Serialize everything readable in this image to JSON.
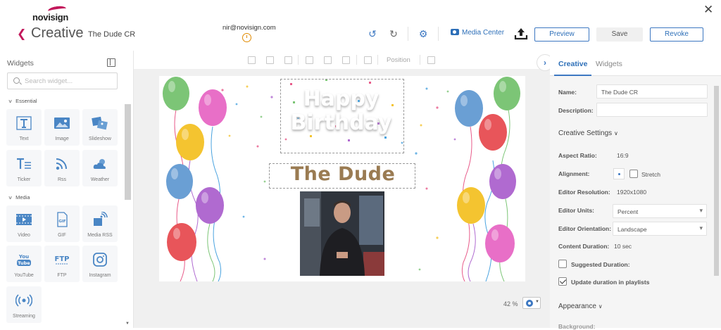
{
  "header": {
    "logo_text": "novisign",
    "app_title": "Creative",
    "creative_name": "The Dude CR",
    "user_email": "nir@novisign.com",
    "media_center_label": "Media Center",
    "preview_label": "Preview",
    "save_label": "Save",
    "revoke_label": "Revoke"
  },
  "widgets_panel": {
    "title": "Widgets",
    "search_placeholder": "Search widget...",
    "sections": [
      {
        "label": "Essential",
        "items": [
          "Text",
          "Image",
          "Slideshow",
          "Ticker",
          "Rss",
          "Weather"
        ]
      },
      {
        "label": "Media",
        "items": [
          "Video",
          "GIF",
          "Media RSS",
          "YouTube",
          "FTP",
          "Instagram",
          "Streaming"
        ]
      }
    ]
  },
  "toolbar": {
    "position_label": "Position"
  },
  "canvas": {
    "happy_text": "Happy",
    "birthday_text": "Birthday",
    "name_text": "The Dude",
    "zoom": "42 %"
  },
  "properties": {
    "tabs": [
      "Creative",
      "Widgets"
    ],
    "name_label": "Name:",
    "name_value": "The Dude CR",
    "description_label": "Description:",
    "description_value": "",
    "creative_settings_label": "Creative Settings",
    "aspect_ratio_label": "Aspect Ratio:",
    "aspect_ratio_value": "16:9",
    "alignment_label": "Alignment:",
    "stretch_label": "Stretch",
    "editor_resolution_label": "Editor Resolution:",
    "editor_resolution_value": "1920x1080",
    "editor_units_label": "Editor Units:",
    "editor_units_value": "Percent",
    "editor_orientation_label": "Editor Orientation:",
    "editor_orientation_value": "Landscape",
    "content_duration_label": "Content Duration:",
    "content_duration_value": "10 sec",
    "suggested_duration_label": "Suggested Duration:",
    "suggested_duration_checked": false,
    "update_duration_label": "Update duration in playlists",
    "update_duration_checked": true,
    "appearance_label": "Appearance",
    "background_label": "Background:"
  },
  "colors": {
    "accent": "#3d78c2",
    "brand": "#c2185b",
    "name_text": "#9a7b52"
  }
}
